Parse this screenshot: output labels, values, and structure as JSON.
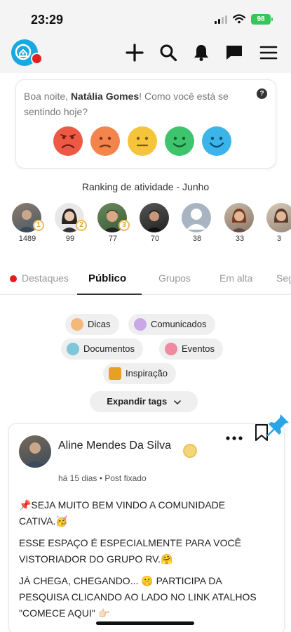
{
  "status_bar": {
    "time": "23:29",
    "battery": "98"
  },
  "header": {
    "logo": "cativa-logo",
    "icons": [
      "plus-icon",
      "search-icon",
      "bell-icon",
      "chat-icon",
      "menu-icon"
    ]
  },
  "mood": {
    "greeting": "Boa noite, ",
    "user_name": "Natália Gomes",
    "question": "! Como você está se sentindo hoje?",
    "options": [
      {
        "name": "very-sad",
        "color": "#ec5a45"
      },
      {
        "name": "sad",
        "color": "#f2844c"
      },
      {
        "name": "neutral",
        "color": "#f6c43a"
      },
      {
        "name": "happy",
        "color": "#3ec46d"
      },
      {
        "name": "very-happy",
        "color": "#3bb4ea"
      }
    ]
  },
  "ranking": {
    "title": "Ranking de atividade - Junho",
    "members": [
      {
        "score": "1489",
        "rank": "1"
      },
      {
        "score": "99",
        "rank": "2"
      },
      {
        "score": "77",
        "rank": "3"
      },
      {
        "score": "70",
        "rank": ""
      },
      {
        "score": "38",
        "rank": ""
      },
      {
        "score": "33",
        "rank": ""
      },
      {
        "score": "3",
        "rank": ""
      }
    ]
  },
  "tabs": [
    {
      "label": "Destaques"
    },
    {
      "label": "Público"
    },
    {
      "label": "Grupos"
    },
    {
      "label": "Em alta"
    },
    {
      "label": "Seg"
    }
  ],
  "tags": [
    {
      "label": "Dicas",
      "color": "#f3b97a"
    },
    {
      "label": "Comunicados",
      "color": "#c9a8e8"
    },
    {
      "label": "Documentos",
      "color": "#7fc6d6"
    },
    {
      "label": "Eventos",
      "color": "#f08aa0"
    },
    {
      "label": "Inspiração",
      "color": "#e8a020"
    }
  ],
  "expand_tags": "Expandir tags",
  "post": {
    "author": "Aline Mendes Da Silva",
    "meta": "há 15 dias • Post fixado",
    "paragraphs": [
      "📌SEJA MUITO BEM VINDO A COMUNIDADE CATIVA.🥳",
      "ESSE ESPAÇO É ESPECIALMENTE PARA VOCÊ VISTORIADOR DO GRUPO RV.🤗",
      "JÁ CHEGA, CHEGANDO... 🤫 PARTICIPA DA PESQUISA CLICANDO AO LADO NO LINK ATALHOS \"COMECE AQUI\" 👉🏻"
    ]
  },
  "colors": {
    "brand": "#1aa8e0",
    "notification": "#e32020",
    "pin": "#2aa6e8"
  }
}
